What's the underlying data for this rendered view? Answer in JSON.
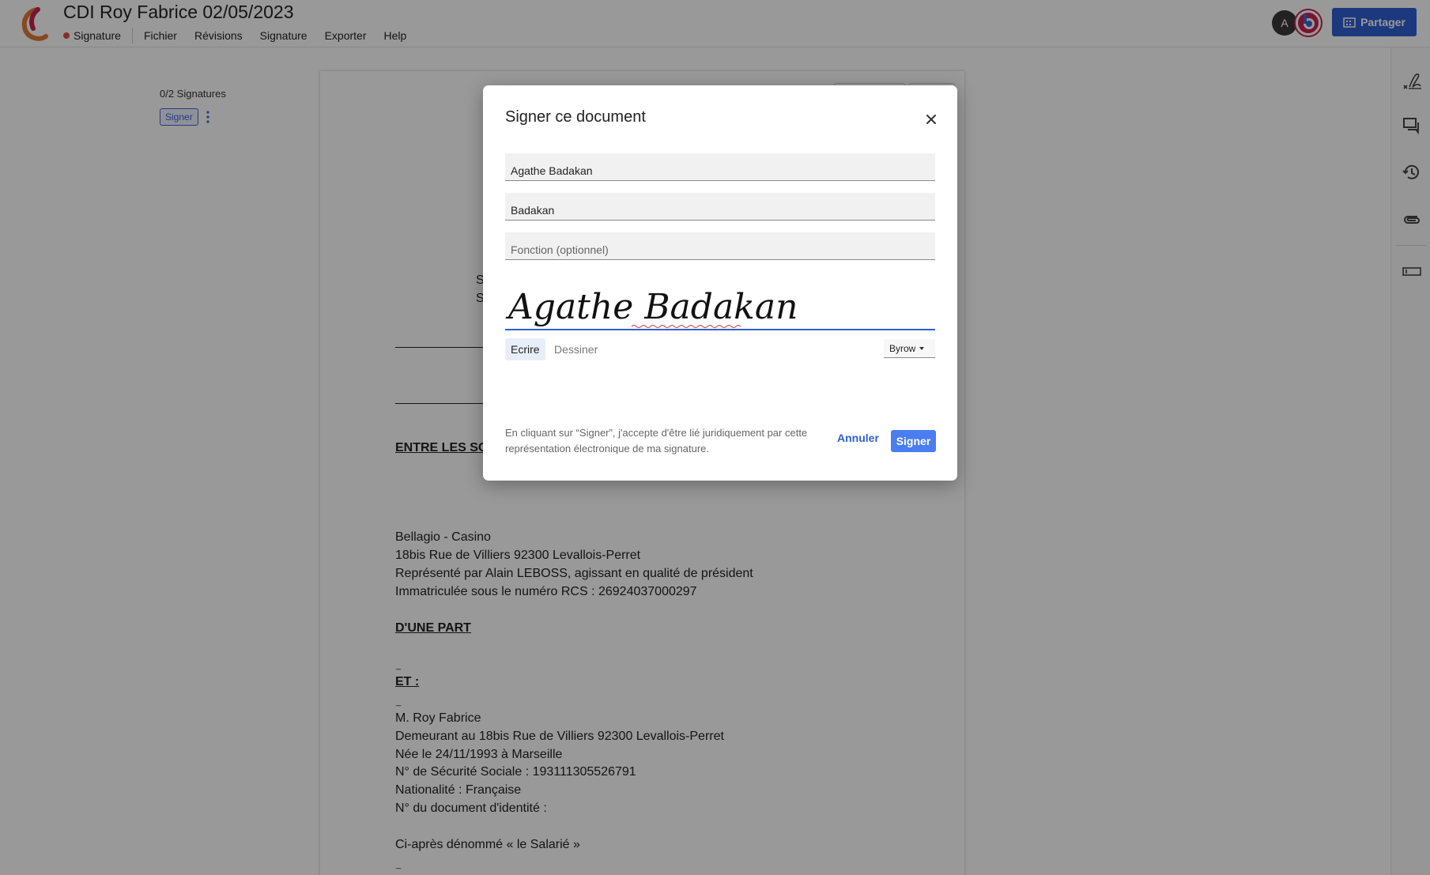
{
  "header": {
    "title": "CDI Roy Fabrice 02/05/2023",
    "status_label": "Signature",
    "menu": [
      "Fichier",
      "Révisions",
      "Signature",
      "Exporter",
      "Help"
    ],
    "avatar_initial": "A",
    "share_label": "Partager",
    "accent_color": "#2f5fd0",
    "status_color": "#e04b4b"
  },
  "left_panel": {
    "signature_count": "0/2 Signatures",
    "signer_label": "Signer"
  },
  "document": {
    "fragment_letters": [
      "S",
      "S"
    ],
    "parties_heading": "ENTRE LES SO",
    "company": [
      "Bellagio - Casino",
      "18bis Rue de Villiers 92300 Levallois-Perret",
      "Représenté par Alain LEBOSS, agissant en qualité de président",
      "Immatriculée sous le numéro RCS : 26924037000297"
    ],
    "part_heading": "D'UNE PART",
    "and_heading": "ET :",
    "employee": [
      "M. Roy Fabrice",
      "Demeurant au 18bis Rue de Villiers 92300 Levallois-Perret",
      "Née le 24/11/1993 à Marseille",
      "N° de Sécurité Sociale : 193111305526791",
      "Nationalité : Française",
      "N° du document d'identité :"
    ],
    "employee_alias": "Ci-après dénommé « le Salarié »"
  },
  "modal": {
    "title": "Signer ce document",
    "full_name": "Agathe Badakan",
    "last_name": "Badakan",
    "function_placeholder": "Fonction (optionnel)",
    "signature_text": "Agathe Badakan",
    "tab_write": "Ecrire",
    "tab_draw": "Dessiner",
    "font_name": "Byrow",
    "legal_text": "En cliquant sur “Signer”, j'accepte d'être lié juridiquement par cette représentation électronique de ma signature.",
    "cancel_label": "Annuler",
    "sign_label": "Signer"
  },
  "right_rail": {
    "icons": [
      "signature-icon",
      "comments-icon",
      "history-icon",
      "attachment-icon",
      "field-icon"
    ]
  }
}
